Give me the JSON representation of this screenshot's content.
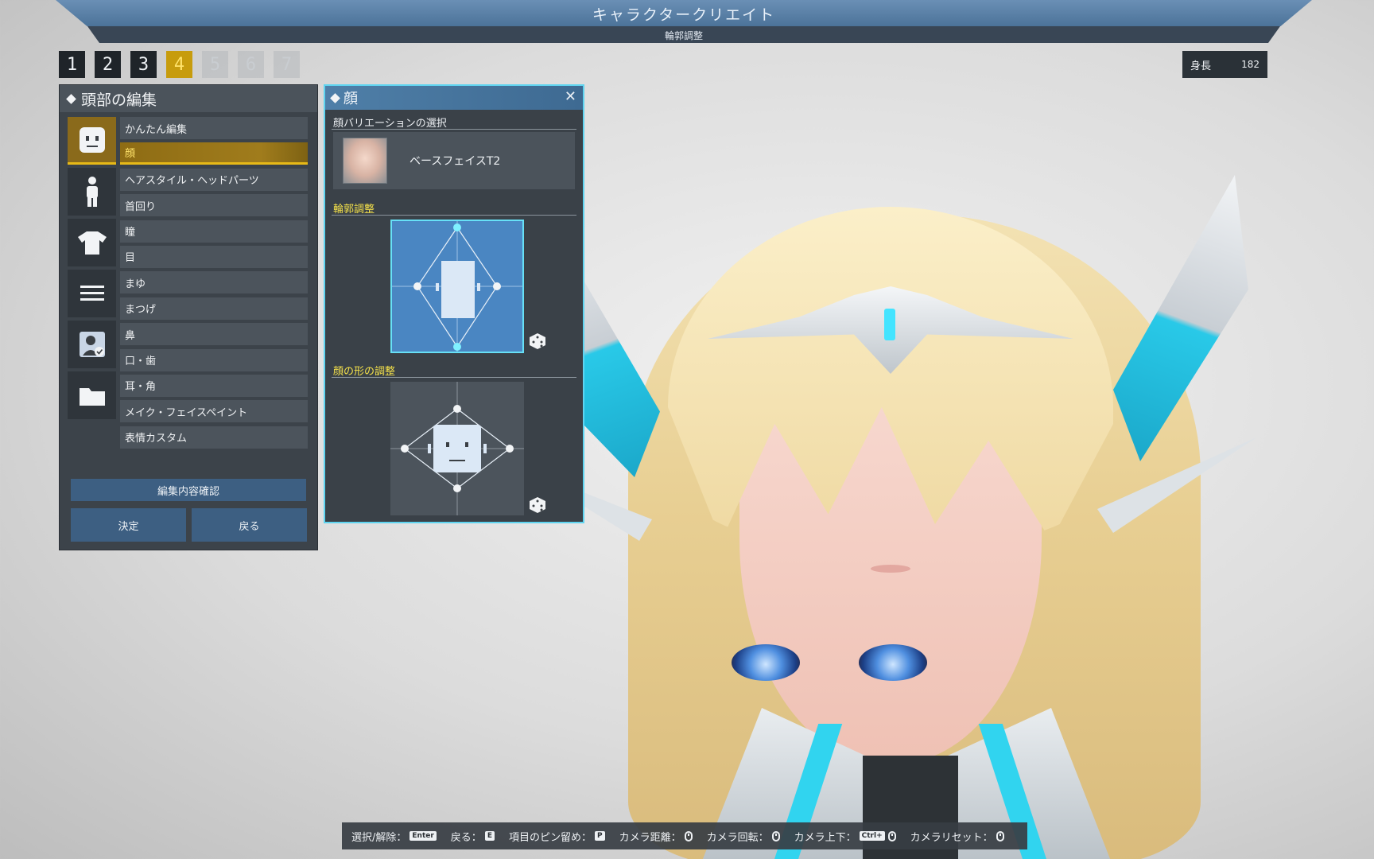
{
  "header": {
    "title": "キャラクタークリエイト",
    "subtitle": "輪郭調整"
  },
  "steps": [
    {
      "label": "1",
      "state": "normal"
    },
    {
      "label": "2",
      "state": "normal"
    },
    {
      "label": "3",
      "state": "normal"
    },
    {
      "label": "4",
      "state": "active"
    },
    {
      "label": "5",
      "state": "disabled"
    },
    {
      "label": "6",
      "state": "disabled"
    },
    {
      "label": "7",
      "state": "disabled"
    }
  ],
  "height": {
    "label": "身長",
    "value": "182"
  },
  "head_panel": {
    "title": "頭部の編集",
    "categories": [
      {
        "icon": "face-icon",
        "active": true
      },
      {
        "icon": "body-icon",
        "active": false
      },
      {
        "icon": "shirt-icon",
        "active": false
      },
      {
        "icon": "menu-icon",
        "active": false
      },
      {
        "icon": "profile-icon",
        "active": false
      },
      {
        "icon": "folder-icon",
        "active": false
      }
    ],
    "items": [
      {
        "label": "かんたん編集",
        "active": false
      },
      {
        "label": "顔",
        "active": true
      },
      {
        "label": "ヘアスタイル・ヘッドパーツ",
        "active": false
      },
      {
        "label": "首回り",
        "active": false
      },
      {
        "label": "瞳",
        "active": false
      },
      {
        "label": "目",
        "active": false
      },
      {
        "label": "まゆ",
        "active": false
      },
      {
        "label": "まつげ",
        "active": false
      },
      {
        "label": "鼻",
        "active": false
      },
      {
        "label": "口・歯",
        "active": false
      },
      {
        "label": "耳・角",
        "active": false
      },
      {
        "label": "メイク・フェイスペイント",
        "active": false
      },
      {
        "label": "表情カスタム",
        "active": false
      }
    ],
    "confirm_label": "編集内容確認",
    "ok_label": "決定",
    "back_label": "戻る"
  },
  "face_panel": {
    "title": "顔",
    "variation_label": "顔バリエーションの選択",
    "variation_name": "ベースフェイスT2",
    "contour_label": "輪郭調整",
    "shape_label": "顔の形の調整"
  },
  "help_bar": [
    {
      "label": "選択/解除：",
      "key": "Enter",
      "kind": "key"
    },
    {
      "label": "戻る：",
      "key": "E",
      "kind": "key"
    },
    {
      "label": "項目のピン留め：",
      "key": "P",
      "kind": "key"
    },
    {
      "label": "カメラ距離：",
      "key": "",
      "kind": "mouse"
    },
    {
      "label": "カメラ回転：",
      "key": "",
      "kind": "mouse"
    },
    {
      "label": "カメラ上下：",
      "key": "Ctrl+",
      "kind": "key-mouse"
    },
    {
      "label": "カメラリセット：",
      "key": "",
      "kind": "mouse"
    }
  ],
  "colors": {
    "accent_gold": "#e7b917",
    "panel_blue": "#4a86c2",
    "highlight_cyan": "#67e0f6",
    "section_yellow": "#f3e04a"
  }
}
